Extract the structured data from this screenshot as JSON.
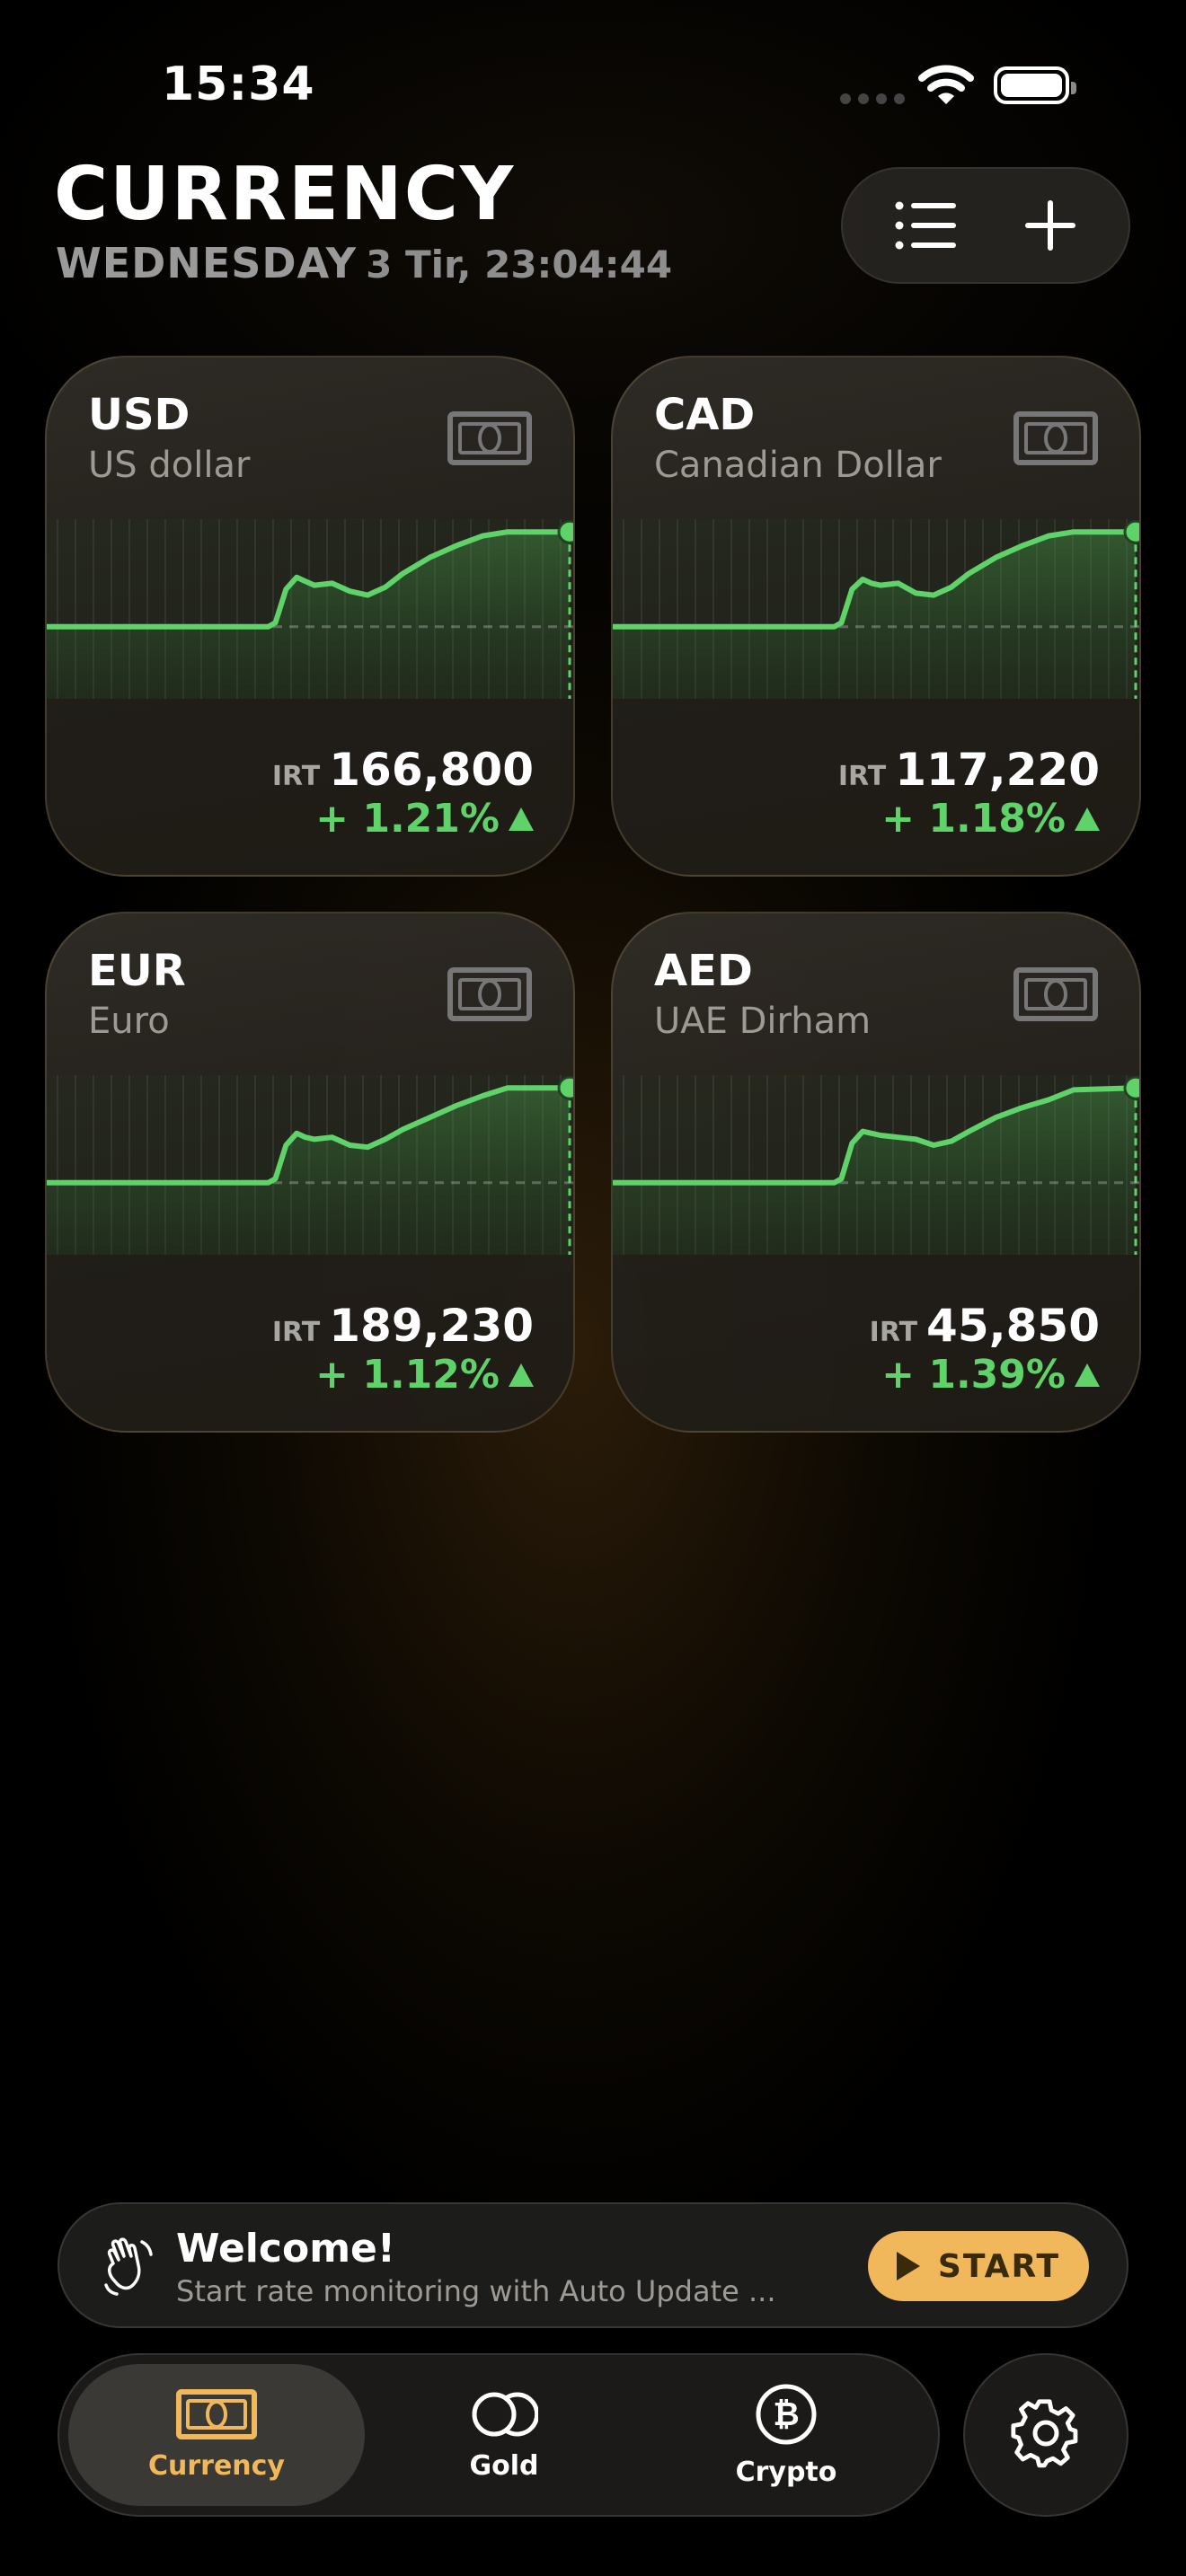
{
  "status_bar": {
    "time": "15:34"
  },
  "header": {
    "title": "CURRENCY",
    "day": "WEDNESDAY",
    "date": "3 Tir, 23:04:44"
  },
  "toolbar": {
    "list_icon": "list-icon",
    "add_icon": "plus-icon"
  },
  "cards": [
    {
      "code": "USD",
      "name": "US dollar",
      "currency_unit": "IRT",
      "price": "166,800",
      "change": "+ 1.21%",
      "trend": "up"
    },
    {
      "code": "CAD",
      "name": "Canadian Dollar",
      "currency_unit": "IRT",
      "price": "117,220",
      "change": "+ 1.18%",
      "trend": "up"
    },
    {
      "code": "EUR",
      "name": "Euro",
      "currency_unit": "IRT",
      "price": "189,230",
      "change": "+ 1.12%",
      "trend": "up"
    },
    {
      "code": "AED",
      "name": "UAE Dirham",
      "currency_unit": "IRT",
      "price": "45,850",
      "change": "+ 1.39%",
      "trend": "up"
    }
  ],
  "welcome": {
    "title": "Welcome!",
    "subtitle": "Start rate monitoring with Auto Update ...",
    "button_label": "START"
  },
  "tabs": [
    {
      "label": "Currency",
      "icon": "banknote-icon",
      "active": true
    },
    {
      "label": "Gold",
      "icon": "coins-icon",
      "active": false
    },
    {
      "label": "Crypto",
      "icon": "bitcoin-icon",
      "active": false
    }
  ],
  "settings_icon": "gear-icon",
  "colors": {
    "accent": "#f0b85a",
    "positive": "#5fd36a",
    "background": "#000000"
  }
}
